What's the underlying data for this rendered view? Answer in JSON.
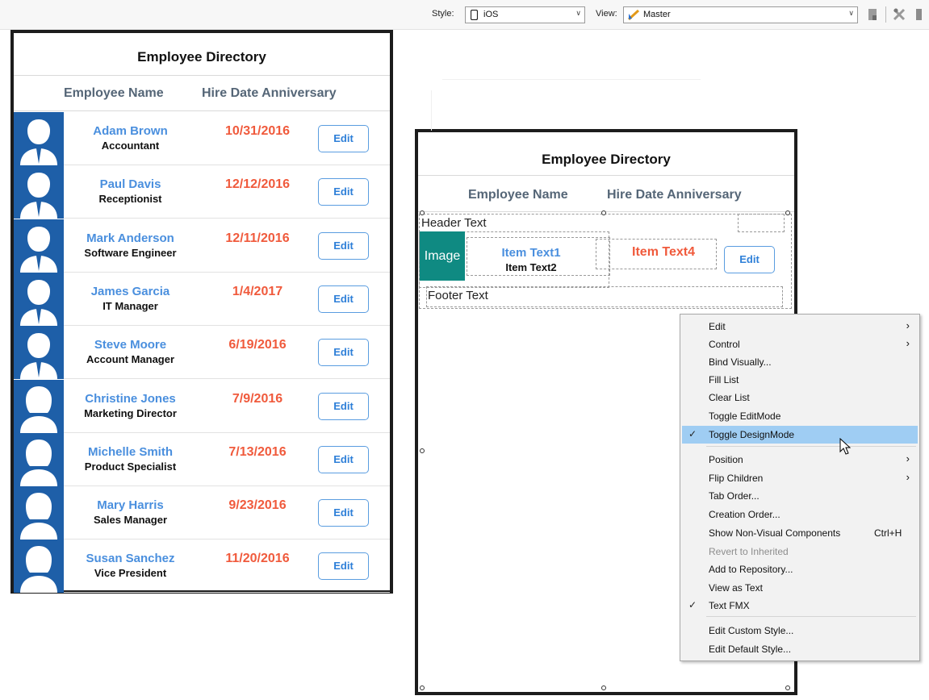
{
  "toolbar": {
    "style_label": "Style:",
    "style_value": "iOS",
    "view_label": "View:",
    "view_value": "Master"
  },
  "live_list": {
    "title": "Employee Directory",
    "col_name": "Employee Name",
    "col_date": "Hire Date Anniversary",
    "employees": [
      {
        "name": "Adam Brown",
        "role": "Accountant",
        "date": "10/31/2016",
        "edit": "Edit",
        "gender": "m"
      },
      {
        "name": "Paul Davis",
        "role": "Receptionist",
        "date": "12/12/2016",
        "edit": "Edit",
        "gender": "m"
      },
      {
        "name": "Mark Anderson",
        "role": "Software Engineer",
        "date": "12/11/2016",
        "edit": "Edit",
        "gender": "m"
      },
      {
        "name": "James Garcia",
        "role": "IT Manager",
        "date": "1/4/2017",
        "edit": "Edit",
        "gender": "m"
      },
      {
        "name": "Steve Moore",
        "role": "Account Manager",
        "date": "6/19/2016",
        "edit": "Edit",
        "gender": "m"
      },
      {
        "name": "Christine Jones",
        "role": "Marketing Director",
        "date": "7/9/2016",
        "edit": "Edit",
        "gender": "f"
      },
      {
        "name": "Michelle Smith",
        "role": "Product Specialist",
        "date": "7/13/2016",
        "edit": "Edit",
        "gender": "f"
      },
      {
        "name": "Mary Harris",
        "role": "Sales Manager",
        "date": "9/23/2016",
        "edit": "Edit",
        "gender": "f"
      },
      {
        "name": "Susan Sanchez",
        "role": "Vice President",
        "date": "11/20/2016",
        "edit": "Edit",
        "gender": "f"
      }
    ]
  },
  "design_list": {
    "title": "Employee Directory",
    "col_name": "Employee Name",
    "col_date": "Hire Date Anniversary",
    "header_text": "Header Text",
    "image": "Image",
    "item_text1": "Item Text1",
    "item_text2": "Item Text2",
    "item_text4": "Item Text4",
    "edit": "Edit",
    "footer_text": "Footer Text"
  },
  "menu": {
    "items": [
      {
        "label": "Edit",
        "submenu": true
      },
      {
        "label": "Control",
        "submenu": true
      },
      {
        "label": "Bind Visually..."
      },
      {
        "label": "Fill List"
      },
      {
        "label": "Clear List"
      },
      {
        "label": "Toggle EditMode"
      },
      {
        "label": "Toggle DesignMode",
        "checked": true,
        "highlighted": true
      },
      {
        "label": "Position",
        "submenu": true
      },
      {
        "label": "Flip Children",
        "submenu": true
      },
      {
        "label": "Tab Order..."
      },
      {
        "label": "Creation Order..."
      },
      {
        "label": "Show Non-Visual Components",
        "shortcut": "Ctrl+H"
      },
      {
        "label": "Revert to Inherited",
        "disabled": true
      },
      {
        "label": "Add to Repository..."
      },
      {
        "label": "View as Text"
      },
      {
        "label": "Text FMX",
        "checked": true
      },
      {
        "label": "Edit Custom Style..."
      },
      {
        "label": "Edit Default Style..."
      }
    ]
  },
  "colors": {
    "accent_blue": "#4a8fde",
    "date_red": "#f05a3c",
    "avatar_bg": "#1e5fa8",
    "design_image_bg": "#0f8a82",
    "menu_highlight": "#9fcdf3"
  }
}
